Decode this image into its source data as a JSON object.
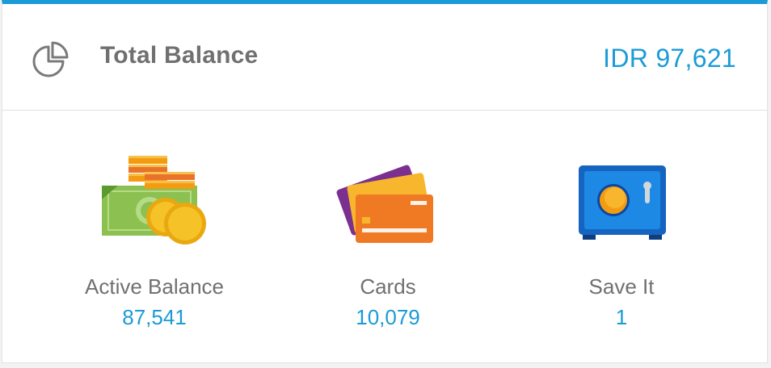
{
  "header": {
    "icon": "pie-chart-icon",
    "title": "Total Balance",
    "total": "IDR 97,621"
  },
  "items": [
    {
      "icon": "money-coins-icon",
      "label": "Active Balance",
      "value": "87,541"
    },
    {
      "icon": "credit-cards-icon",
      "label": "Cards",
      "value": "10,079"
    },
    {
      "icon": "safe-vault-icon",
      "label": "Save It",
      "value": "1"
    }
  ],
  "colors": {
    "accent": "#1a9bd7",
    "text": "#707070",
    "divider": "#e1e1e1"
  }
}
